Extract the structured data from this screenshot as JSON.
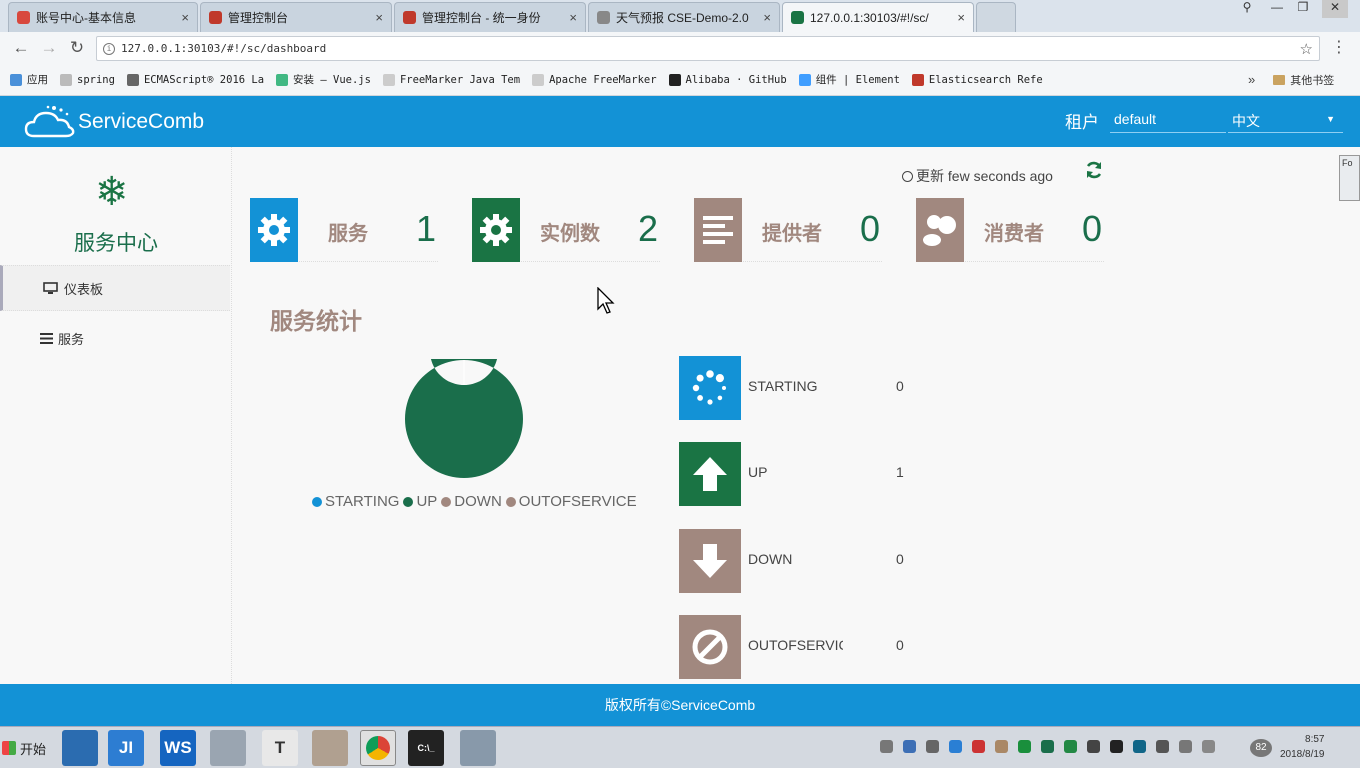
{
  "browser": {
    "tabs": [
      {
        "label": "账号中心-基本信息",
        "close": "×",
        "color": "#d8483d"
      },
      {
        "label": "管理控制台",
        "close": "×",
        "color": "#c0392b"
      },
      {
        "label": "管理控制台 - 统一身份",
        "close": "×",
        "color": "#c0392b"
      },
      {
        "label": "天气预报 CSE-Demo-2.0",
        "close": "×",
        "color": "#888888"
      },
      {
        "label": "127.0.0.1:30103/#!/sc/",
        "close": "×",
        "color": "#1a7444"
      }
    ],
    "window_controls": [
      "⚲",
      "—",
      "❐",
      "✕"
    ],
    "nav": {
      "back": "←",
      "forward": "→",
      "reload": "↻"
    },
    "address": "127.0.0.1:30103/#!/sc/dashboard",
    "star": "☆",
    "menu": "⋮",
    "bookmarks": [
      {
        "label": "应用",
        "color": "#4a90d9"
      },
      {
        "label": "spring",
        "color": "#bbbbbb"
      },
      {
        "label": "ECMAScript® 2016 La",
        "color": "#666666"
      },
      {
        "label": "安装 — Vue.js",
        "color": "#41b883"
      },
      {
        "label": "FreeMarker Java Tem",
        "color": "#cccccc"
      },
      {
        "label": "Apache FreeMarker",
        "color": "#cccccc"
      },
      {
        "label": "Alibaba · GitHub",
        "color": "#222222"
      },
      {
        "label": "组件 | Element",
        "color": "#409eff"
      },
      {
        "label": "Elasticsearch Refe",
        "color": "#c0392b"
      }
    ],
    "more": "»",
    "other_bookmarks": "其他书签"
  },
  "header": {
    "brand": "ServiceComb",
    "tenant_label": "租户",
    "tenant_value": "default",
    "language": "中文",
    "caret": "▼"
  },
  "sidebar": {
    "icon": "snowflake-icon",
    "title": "服务中心",
    "items": [
      {
        "label": "仪表板",
        "icon": "monitor-icon"
      },
      {
        "label": "服务",
        "icon": "list-icon"
      }
    ]
  },
  "dashboard": {
    "updated_prefix": "更新",
    "updated_text": "few seconds ago",
    "cards": [
      {
        "label": "服务",
        "value": "1",
        "color": "#1392d6",
        "icon": "gear-icon"
      },
      {
        "label": "实例数",
        "value": "2",
        "color": "#1a7444",
        "icon": "gear-icon"
      },
      {
        "label": "提供者",
        "value": "0",
        "color": "#a1887f",
        "icon": "lines-icon"
      },
      {
        "label": "消费者",
        "value": "0",
        "color": "#a1887f",
        "icon": "users-icon"
      }
    ],
    "stats_title": "服务统计",
    "chart_data": {
      "type": "pie",
      "categories": [
        "STARTING",
        "UP",
        "DOWN",
        "OUTOFSERVICE"
      ],
      "values": [
        0,
        1,
        0,
        0
      ],
      "colors": [
        "#1392d6",
        "#1a6e4b",
        "#a1887f",
        "#a1887f"
      ],
      "legend": "bottom"
    },
    "statuses": [
      {
        "label": "STARTING",
        "value": "0",
        "color": "#1392d6",
        "icon": "spinner-icon"
      },
      {
        "label": "UP",
        "value": "1",
        "color": "#1a7444",
        "icon": "arrow-up-icon"
      },
      {
        "label": "DOWN",
        "value": "0",
        "color": "#a1887f",
        "icon": "arrow-down-icon"
      },
      {
        "label": "OUTOFSERVICE",
        "value": "0",
        "color": "#a1887f",
        "icon": "ban-icon"
      }
    ]
  },
  "footer": {
    "text": "版权所有©ServiceComb"
  },
  "taskbar": {
    "start": "开始",
    "apps": [
      "",
      "JI",
      "WS",
      "",
      "T",
      "",
      "",
      "C:\\_",
      ""
    ],
    "clock_time": "8:57",
    "clock_date": "2018/8/19",
    "badge": "82"
  },
  "side_panel": {
    "label": "Fo"
  }
}
